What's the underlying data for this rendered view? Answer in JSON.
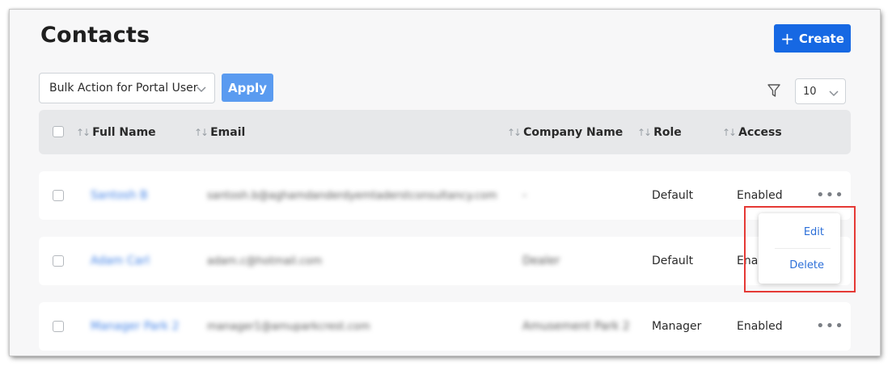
{
  "header": {
    "title": "Contacts",
    "create_label": "Create"
  },
  "toolbar": {
    "bulk_action": "Bulk Action for Portal User",
    "apply_label": "Apply",
    "page_size": "10"
  },
  "table": {
    "columns": {
      "full_name": "Full Name",
      "email": "Email",
      "company": "Company Name",
      "role": "Role",
      "access": "Access"
    },
    "rows": [
      {
        "full_name": "Santosh B",
        "email": "santosh.b@aghamdanderdyemtaderstconsultancy.com",
        "company": "-",
        "role": "Default",
        "access": "Enabled"
      },
      {
        "full_name": "Adam Carl",
        "email": "adam.c@hotmail.com",
        "company": "Dealer",
        "role": "Default",
        "access": "Enabled"
      },
      {
        "full_name": "Manager Park 2",
        "email": "manager1@amuparkcrest.com",
        "company": "Amusement Park 2",
        "role": "Manager",
        "access": "Enabled"
      }
    ]
  },
  "row_menu": {
    "edit_label": "Edit",
    "delete_label": "Delete"
  }
}
